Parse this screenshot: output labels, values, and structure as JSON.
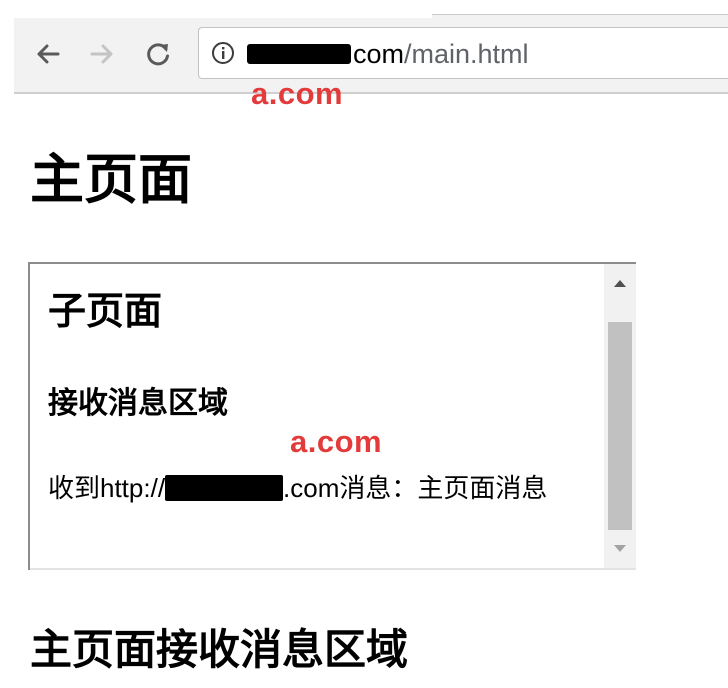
{
  "browser": {
    "url_host_suffix": "com",
    "url_path": "/main.html"
  },
  "annotations": {
    "top_label": "a.com",
    "iframe_label": "a.com"
  },
  "page": {
    "title": "主页面",
    "bottom_heading": "主页面接收消息区域"
  },
  "iframe": {
    "title": "子页面",
    "receive_heading": "接收消息区域",
    "message_prefix": "收到http://",
    "message_suffix": ".com消息：主页面消息"
  },
  "colors": {
    "annotation_red": "#e33b3b",
    "toolbar_bg": "#f2f2f2",
    "scrollbar_thumb": "#c1c1c1"
  },
  "icons": [
    "back-arrow-icon",
    "forward-arrow-icon",
    "reload-icon",
    "info-icon",
    "scroll-up-icon",
    "scroll-down-icon"
  ]
}
